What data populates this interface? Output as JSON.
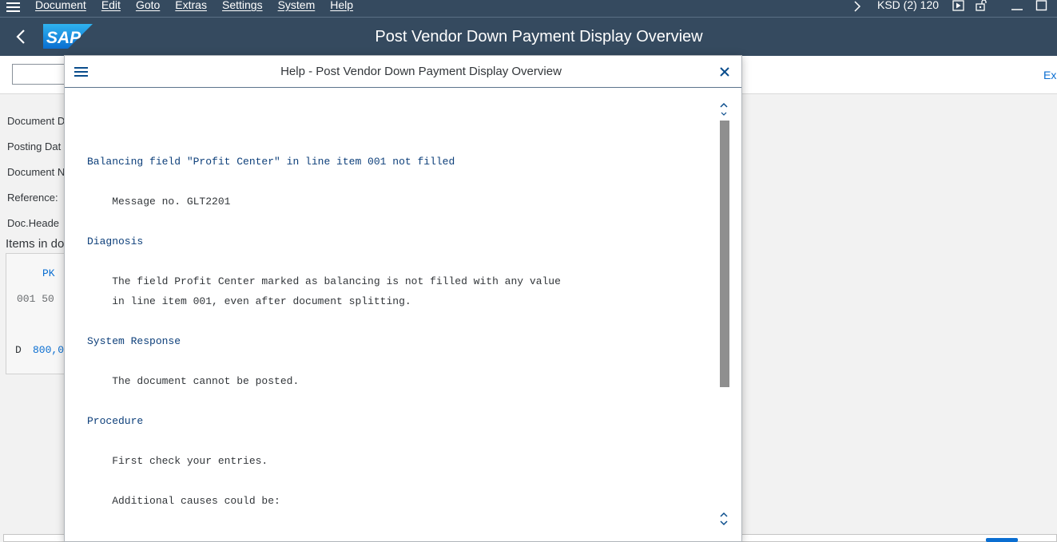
{
  "menu": {
    "items": [
      "Document",
      "Edit",
      "Goto",
      "Extras",
      "Settings",
      "System",
      "Help"
    ],
    "system_info": "KSD (2) 120"
  },
  "header": {
    "title": "Post Vendor Down Payment Display Overview",
    "logo_text": "SAP"
  },
  "toolbar": {
    "exit_label": "Exi"
  },
  "form": {
    "labels": [
      "Document D",
      "Posting Dat",
      "Document N",
      "Reference:",
      "Doc.Heade"
    ],
    "items_title": "Items in do",
    "table": {
      "header_pk": "PK",
      "row1": "001 50",
      "row2_flag": "D",
      "row2_amount": "800,0"
    }
  },
  "dialog": {
    "title": "Help - Post Vendor Down Payment Display Overview",
    "lines": [
      {
        "text": "Balancing field \"Profit Center\" in line item 001 not filled",
        "kind": "heading"
      },
      {
        "text": "    Message no. GLT2201",
        "kind": "body"
      },
      {
        "text": "Diagnosis",
        "kind": "heading"
      },
      {
        "text": "    The field Profit Center marked as balancing is not filled with any value",
        "kind": "body"
      },
      {
        "text": "    in line item 001, even after document splitting.",
        "kind": "body"
      },
      {
        "text": "System Response",
        "kind": "heading"
      },
      {
        "text": "    The document cannot be posted.",
        "kind": "body"
      },
      {
        "text": "Procedure",
        "kind": "heading"
      },
      {
        "text": "    First check your entries.",
        "kind": "body"
      },
      {
        "text": "    Additional causes could be:",
        "kind": "body"
      }
    ]
  },
  "colors": {
    "shell": "#354a5f",
    "link_blue": "#0a6ed1",
    "heading_blue": "#0d3f7a"
  }
}
